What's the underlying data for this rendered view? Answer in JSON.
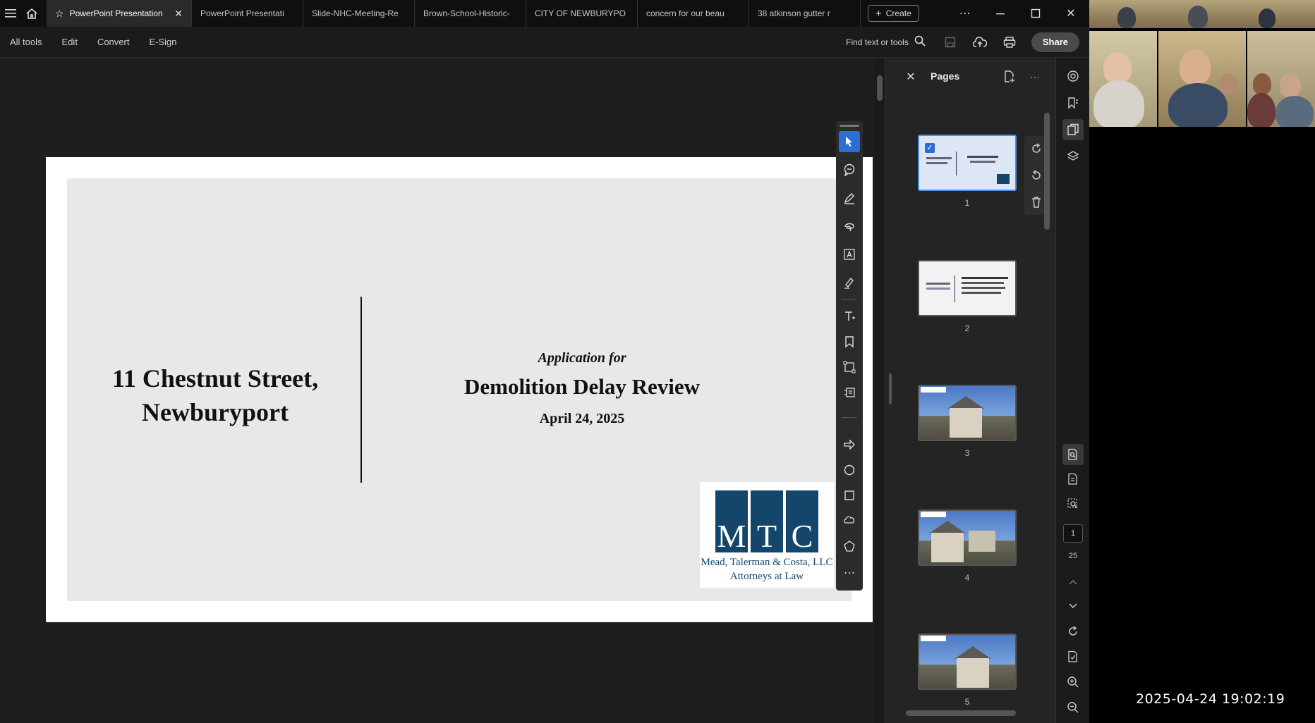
{
  "tabs": [
    {
      "label": "PowerPoint Presentation",
      "active": true
    },
    {
      "label": "PowerPoint Presentati"
    },
    {
      "label": "Slide-NHC-Meeting-Re"
    },
    {
      "label": "Brown-School-Historic-"
    },
    {
      "label": "CITY OF NEWBURYPO"
    },
    {
      "label": "concern for our beau"
    },
    {
      "label": "38 atkinson gutter r"
    }
  ],
  "create_label": "Create",
  "menu": {
    "items": [
      "All tools",
      "Edit",
      "Convert",
      "E-Sign"
    ],
    "find_label": "Find text or tools",
    "share_label": "Share"
  },
  "slide": {
    "left_title_line1": "11 Chestnut Street,",
    "left_title_line2": "Newburyport",
    "application_for": "Application for",
    "main_title": "Demolition Delay Review",
    "date": "April 24, 2025",
    "logo_letters": [
      "M",
      "T",
      "C"
    ],
    "logo_firm": "Mead, Talerman & Costa, LLC",
    "logo_subtitle": "Attorneys at Law"
  },
  "pages_panel": {
    "title": "Pages",
    "thumbnails": [
      {
        "number": "1",
        "selected": true
      },
      {
        "number": "2"
      },
      {
        "number": "3"
      },
      {
        "number": "4"
      },
      {
        "number": "5"
      }
    ]
  },
  "navigation": {
    "current_page": "1",
    "total_pages": "25"
  },
  "timestamp": "2025-04-24  19:02:19",
  "colors": {
    "accent": "#2b6fd6",
    "logo_blue": "#14466b",
    "slide_bg": "#e8e8e8"
  }
}
